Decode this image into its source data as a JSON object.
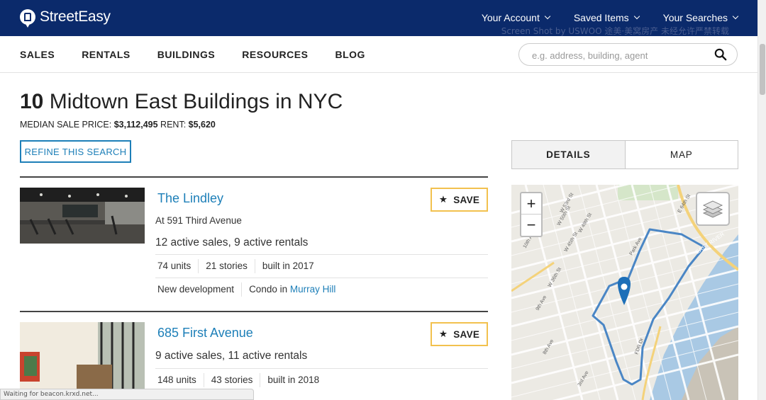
{
  "brand": {
    "name": "StreetEasy"
  },
  "top_menu": [
    {
      "label": "Your Account"
    },
    {
      "label": "Saved Items"
    },
    {
      "label": "Your Searches"
    }
  ],
  "watermark": "Screen Shot by USWOO 途美·美窝房产 未经允许严禁转载",
  "nav": {
    "links": [
      "SALES",
      "RENTALS",
      "BUILDINGS",
      "RESOURCES",
      "BLOG"
    ]
  },
  "search": {
    "placeholder": "e.g. address, building, agent",
    "icon": "search-icon"
  },
  "header": {
    "count": "10",
    "title_rest": "Midtown East Buildings in NYC",
    "median_label": "MEDIAN SALE PRICE:",
    "median_value": "$3,112,495",
    "rent_label": "RENT:",
    "rent_value": "$5,620",
    "refine_label": "REFINE THIS SEARCH"
  },
  "listings": [
    {
      "name": "The Lindley",
      "address": "At 591 Third Avenue",
      "active": "12 active sales, 9 active rentals",
      "units": "74 units",
      "stories": "21 stories",
      "built": "built in 2017",
      "type": "New development",
      "condo_prefix": "Condo in",
      "neighborhood": "Murray Hill",
      "save_label": "SAVE"
    },
    {
      "name": "685 First Avenue",
      "active": "9 active sales, 11 active rentals",
      "units": "148 units",
      "stories": "43 stories",
      "built": "built in 2018",
      "save_label": "SAVE"
    }
  ],
  "view_toggle": {
    "details": "DETAILS",
    "map": "MAP",
    "active": "details"
  },
  "map": {
    "zoom_in": "+",
    "zoom_out": "−",
    "street_labels": [
      "W 53rd St",
      "W 50th St",
      "W 49th St",
      "W 45th St",
      "W 36th St",
      "10th Ave",
      "9th Ave",
      "8th Ave",
      "Park Ave",
      "E 64th St",
      "3rd Ave",
      "FDR Dr"
    ],
    "river_label": "EAST RIVER",
    "colors": {
      "boundary": "#4a86c5",
      "pin": "#1d6fb8",
      "water": "#a9c9e4"
    }
  },
  "status_bar": "Waiting for beacon.krxd.net..."
}
